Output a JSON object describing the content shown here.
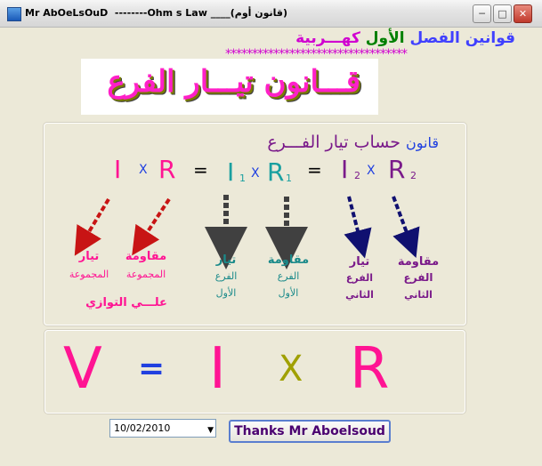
{
  "window": {
    "title": "Mr AbOeLsOuD  --------Ohm s Law ____(قانون أوم)",
    "minimize": "─",
    "maximize": "□",
    "close": "✕",
    "icon": "app-icon"
  },
  "header": {
    "part1": "قوانين الفصل",
    "part2": " الأول ",
    "part3": "كهـــربية",
    "stars": "**********************************"
  },
  "banner": {
    "text": "قـــانون تيـــار الفرع"
  },
  "panel": {
    "title_a": "قانون",
    "title_b": " حساب ",
    "title_c": "تيار الفـــرع",
    "eq": {
      "I": "I",
      "x1": "X",
      "R": "R",
      "eq1": "=",
      "I1": "I",
      "sub1a": "1",
      "x2": "X",
      "R1": "R",
      "sub1b": "1",
      "eq2": "=",
      "I2": "I",
      "sub2a": "2",
      "x3": "X",
      "R2": "R",
      "sub2b": "2"
    },
    "labels": {
      "l1a": "تيار",
      "l1b": "المجموعة",
      "l1c": "علـــي التوازي",
      "l2a": "مقاومة",
      "l2b": "المجموعة",
      "l3a": "تيار",
      "l3b": "الفرع",
      "l3c": "الأول",
      "l4a": "مقاومة",
      "l4b": "الفرع",
      "l4c": "الأول",
      "l5a": "تيار",
      "l5b": "الفرع",
      "l5c": "الثاني",
      "l6a": "مقاومة",
      "l6b": "الفرع",
      "l6c": "الثاني"
    }
  },
  "formula": {
    "V": "V",
    "eq": "=",
    "I": "I",
    "x": "X",
    "R": "R"
  },
  "date_picker": {
    "value": "10/02/2010",
    "icon": "dropdown-arrow-icon"
  },
  "thanks_button": {
    "label": "Thanks Mr Aboelsoud"
  },
  "colors": {
    "title_bar": "#e4e4e4",
    "pink": "#ff1493",
    "blue": "#2040e0",
    "teal": "#1aa0a0",
    "purple": "#7a1a8a",
    "olive": "#a0a000",
    "red_arrow": "#c81414",
    "navy_arrow": "#101070",
    "dark_arrow": "#404040"
  }
}
